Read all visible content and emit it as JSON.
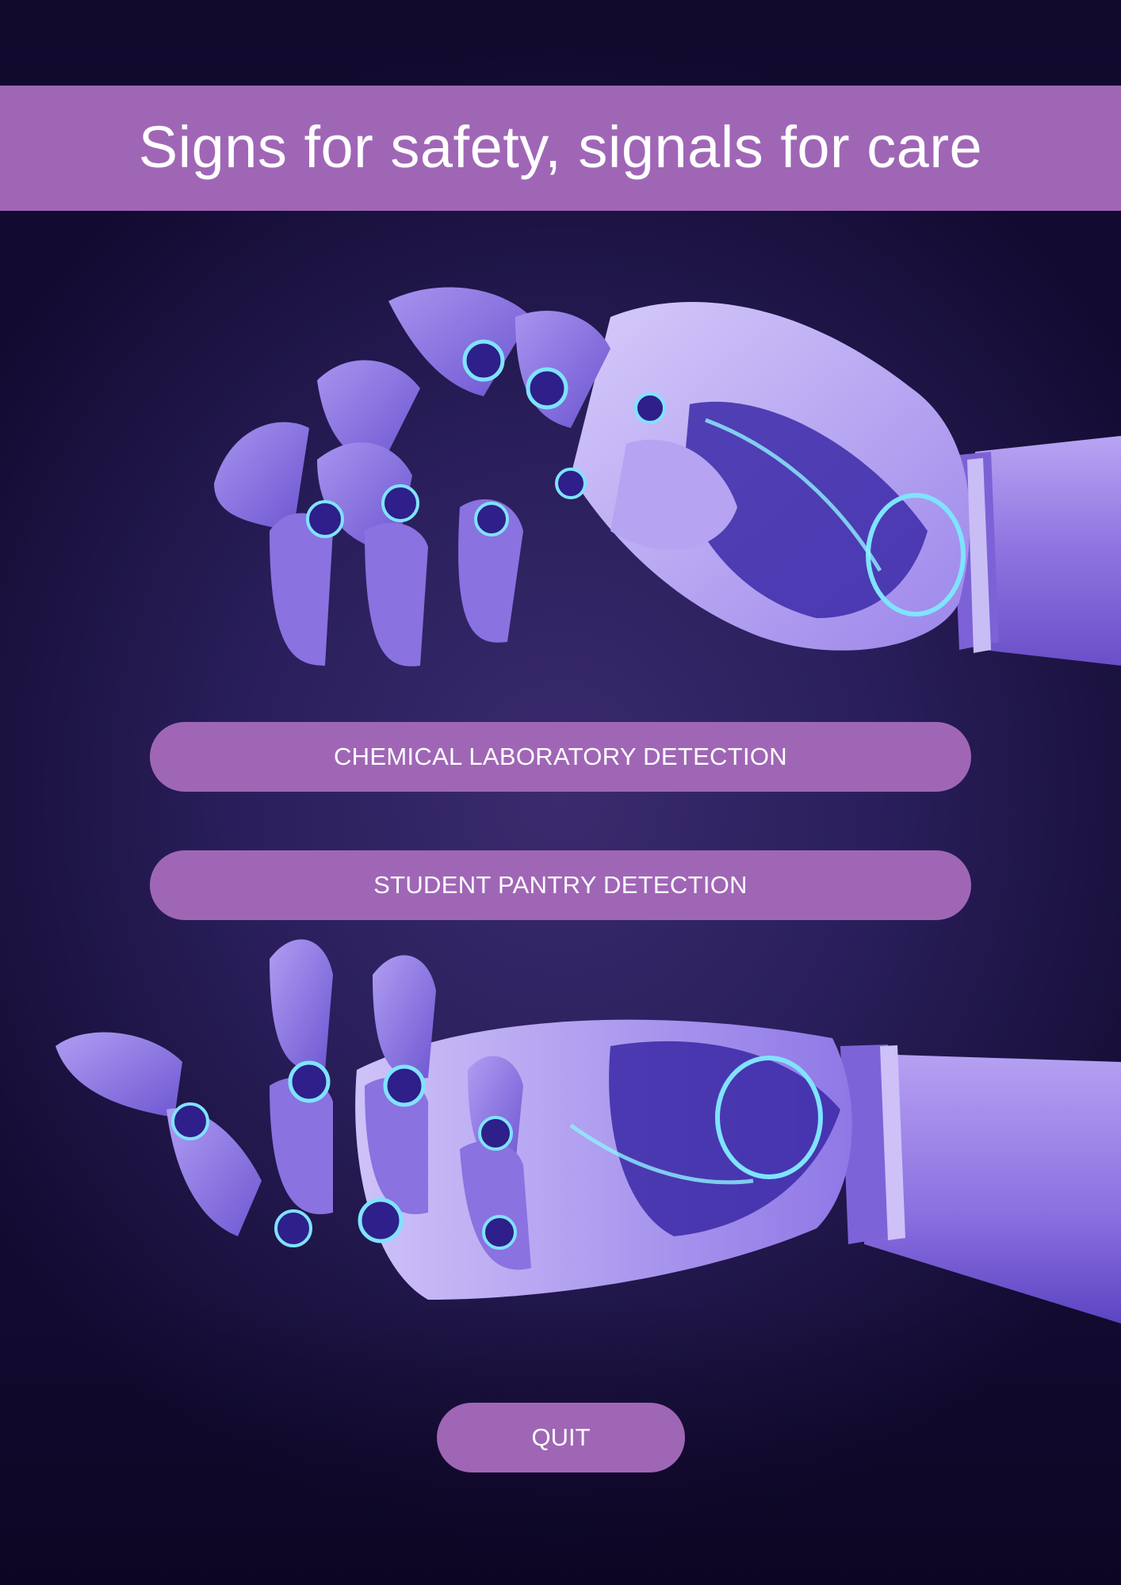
{
  "app": {
    "title": "Signs for safety, signals for care"
  },
  "menu": {
    "chemical_label": "CHEMICAL LABORATORY DETECTION",
    "pantry_label": "STUDENT PANTRY DETECTION",
    "quit_label": "QUIT"
  },
  "images": {
    "top": "robotic-hand-reaching-down-image",
    "bottom": "robotic-hand-open-palm-image"
  },
  "colors": {
    "accent": "#a066b6",
    "background_dark": "#1b1240",
    "background_mid": "#3a2b6e",
    "text": "#ffffff",
    "robot_lavender": "#9b84e6",
    "robot_glow": "#7fe3ff"
  }
}
